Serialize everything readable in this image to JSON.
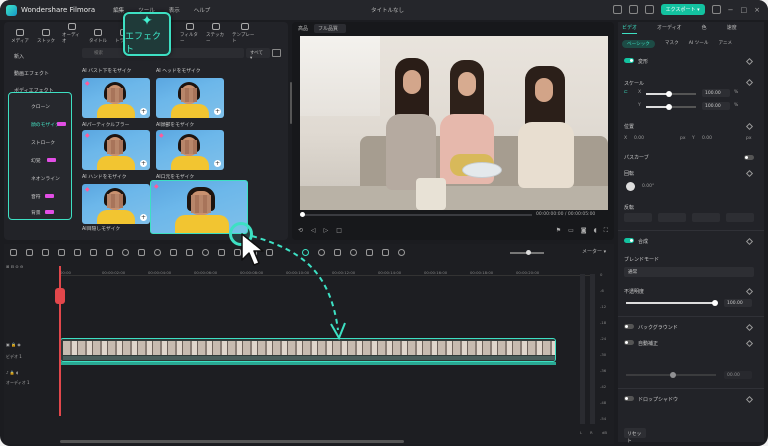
{
  "app": {
    "name": "Wondershare Filmora",
    "title": "タイトルなし",
    "menu": [
      "編集",
      "ツール",
      "表示",
      "ヘルプ"
    ],
    "export_label": "エクスポート ▾"
  },
  "tabs": [
    {
      "label": "メディア",
      "icon": "media-icon"
    },
    {
      "label": "ストック",
      "icon": "stock-icon"
    },
    {
      "label": "オーディオ",
      "icon": "audio-icon"
    },
    {
      "label": "タイトル",
      "icon": "title-icon"
    },
    {
      "label": "トランジ",
      "icon": "transition-icon"
    },
    {
      "label": "フィルター",
      "icon": "filter-icon"
    },
    {
      "label": "ステッカー",
      "icon": "sticker-icon"
    },
    {
      "label": "テンプレート",
      "icon": "template-icon"
    }
  ],
  "effect_tab": {
    "label": "エフェクト",
    "icon": "sparkle-icon"
  },
  "sidebar": {
    "items": [
      "新入",
      "動画エフェクト",
      "ボディエフェクト"
    ],
    "subitems": [
      {
        "label": "クローン",
        "badge": false
      },
      {
        "label": "顔のモザイク",
        "badge": true,
        "selected": true
      },
      {
        "label": "ストローク",
        "badge": false
      },
      {
        "label": "幻覚",
        "badge": true
      },
      {
        "label": "ネオンライン",
        "badge": false
      },
      {
        "label": "音符",
        "badge": true
      },
      {
        "label": "背景",
        "badge": true
      }
    ]
  },
  "search": {
    "placeholder": "検索",
    "filter_label": "すべて ▾"
  },
  "cards": [
    {
      "label": "AI バスト下をモザイク"
    },
    {
      "label": "AI ヘッドをモザイク"
    },
    {
      "label": "AIパーティクルブラー"
    },
    {
      "label": "AI顔部をモザイク"
    },
    {
      "label": "AI ハンドをモザイク"
    },
    {
      "label": "AI口元をモザイク"
    },
    {
      "label": "AI目隠しモザイク"
    },
    {
      "label": ""
    }
  ],
  "player": {
    "mode": "高品",
    "quality": "フル品質",
    "time_current": "00:00:00:00",
    "time_total": "00:00:05:00"
  },
  "right_panel": {
    "tabs": [
      "ビデオ",
      "オーディオ",
      "色",
      "速度"
    ],
    "subtabs": [
      "ベーシック",
      "マスク",
      "AI ツール",
      "アニメ"
    ],
    "sections": {
      "transform": "変形",
      "scale": "スケール",
      "scale_x": "100.00",
      "scale_y": "100.00",
      "percent": "%",
      "position": "位置",
      "pos_x_label": "X",
      "pos_x": "0.00",
      "pos_y_label": "Y",
      "pos_y": "0.00",
      "px": "px",
      "path_curve": "パスカーブ",
      "rotate": "回転",
      "rotate_value": "0.00°",
      "flip": "反転",
      "composite": "合成",
      "blend_mode": "ブレンドモード",
      "blend_value": "通常",
      "opacity": "不透明度",
      "opacity_value": "100.00",
      "background": "バックグラウンド",
      "auto_correct": "自動補正",
      "auto_value": "00.00",
      "drop_shadow": "ドロップシャドウ",
      "reset": "リセット"
    }
  },
  "timeline": {
    "meter_label": "メーター ▾",
    "ruler": [
      "00:00",
      "00:00:02:00",
      "00:00:04:00",
      "00:00:06:00",
      "00:00:08:00",
      "00:00:10:00",
      "00:00:12:00",
      "00:00:14:00",
      "00:00:16:00",
      "00:00:18:00",
      "00:00:20:00"
    ],
    "tracks": [
      {
        "label": "ビデオ 1"
      },
      {
        "label": "オーディオ 1"
      }
    ],
    "vu_scale": [
      "0",
      "-6",
      "-12",
      "-18",
      "-24",
      "-30",
      "-36",
      "-42",
      "-48",
      "-54"
    ],
    "vu_lr": [
      "L",
      "R",
      "dB"
    ]
  },
  "colors": {
    "accent": "#3de0c3",
    "export": "#13c2a0",
    "playhead": "#e2474b"
  }
}
